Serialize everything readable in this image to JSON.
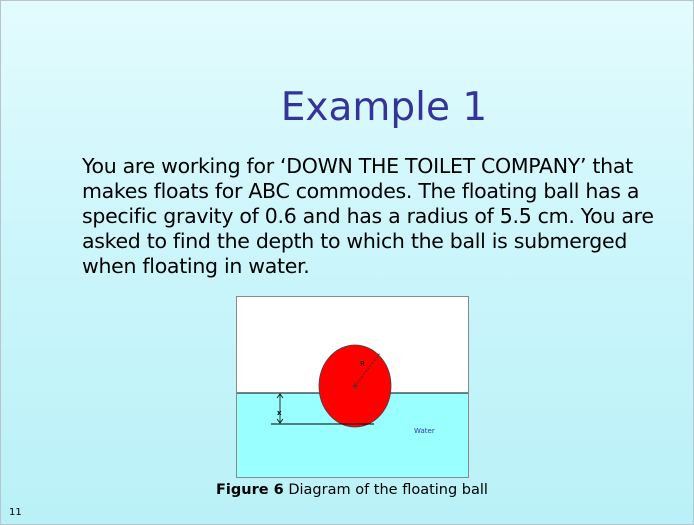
{
  "slide": {
    "title": "Example 1",
    "body": "You are working for ‘DOWN THE TOILET COMPANY’ that makes floats for ABC commodes.  The floating ball has a specific gravity of 0.6 and has a radius of 5.5 cm.  You are asked to find the depth to which the ball is submerged when floating in water.",
    "figure": {
      "radius_label": "R",
      "depth_label": "x",
      "water_label": "Water",
      "caption_label": "Figure 6",
      "caption_text": " Diagram of the floating ball"
    },
    "slide_number": "11"
  },
  "colors": {
    "title": "#333399",
    "water": "#99ffff",
    "ball": "#ff0000",
    "water_label": "#3333cc"
  }
}
